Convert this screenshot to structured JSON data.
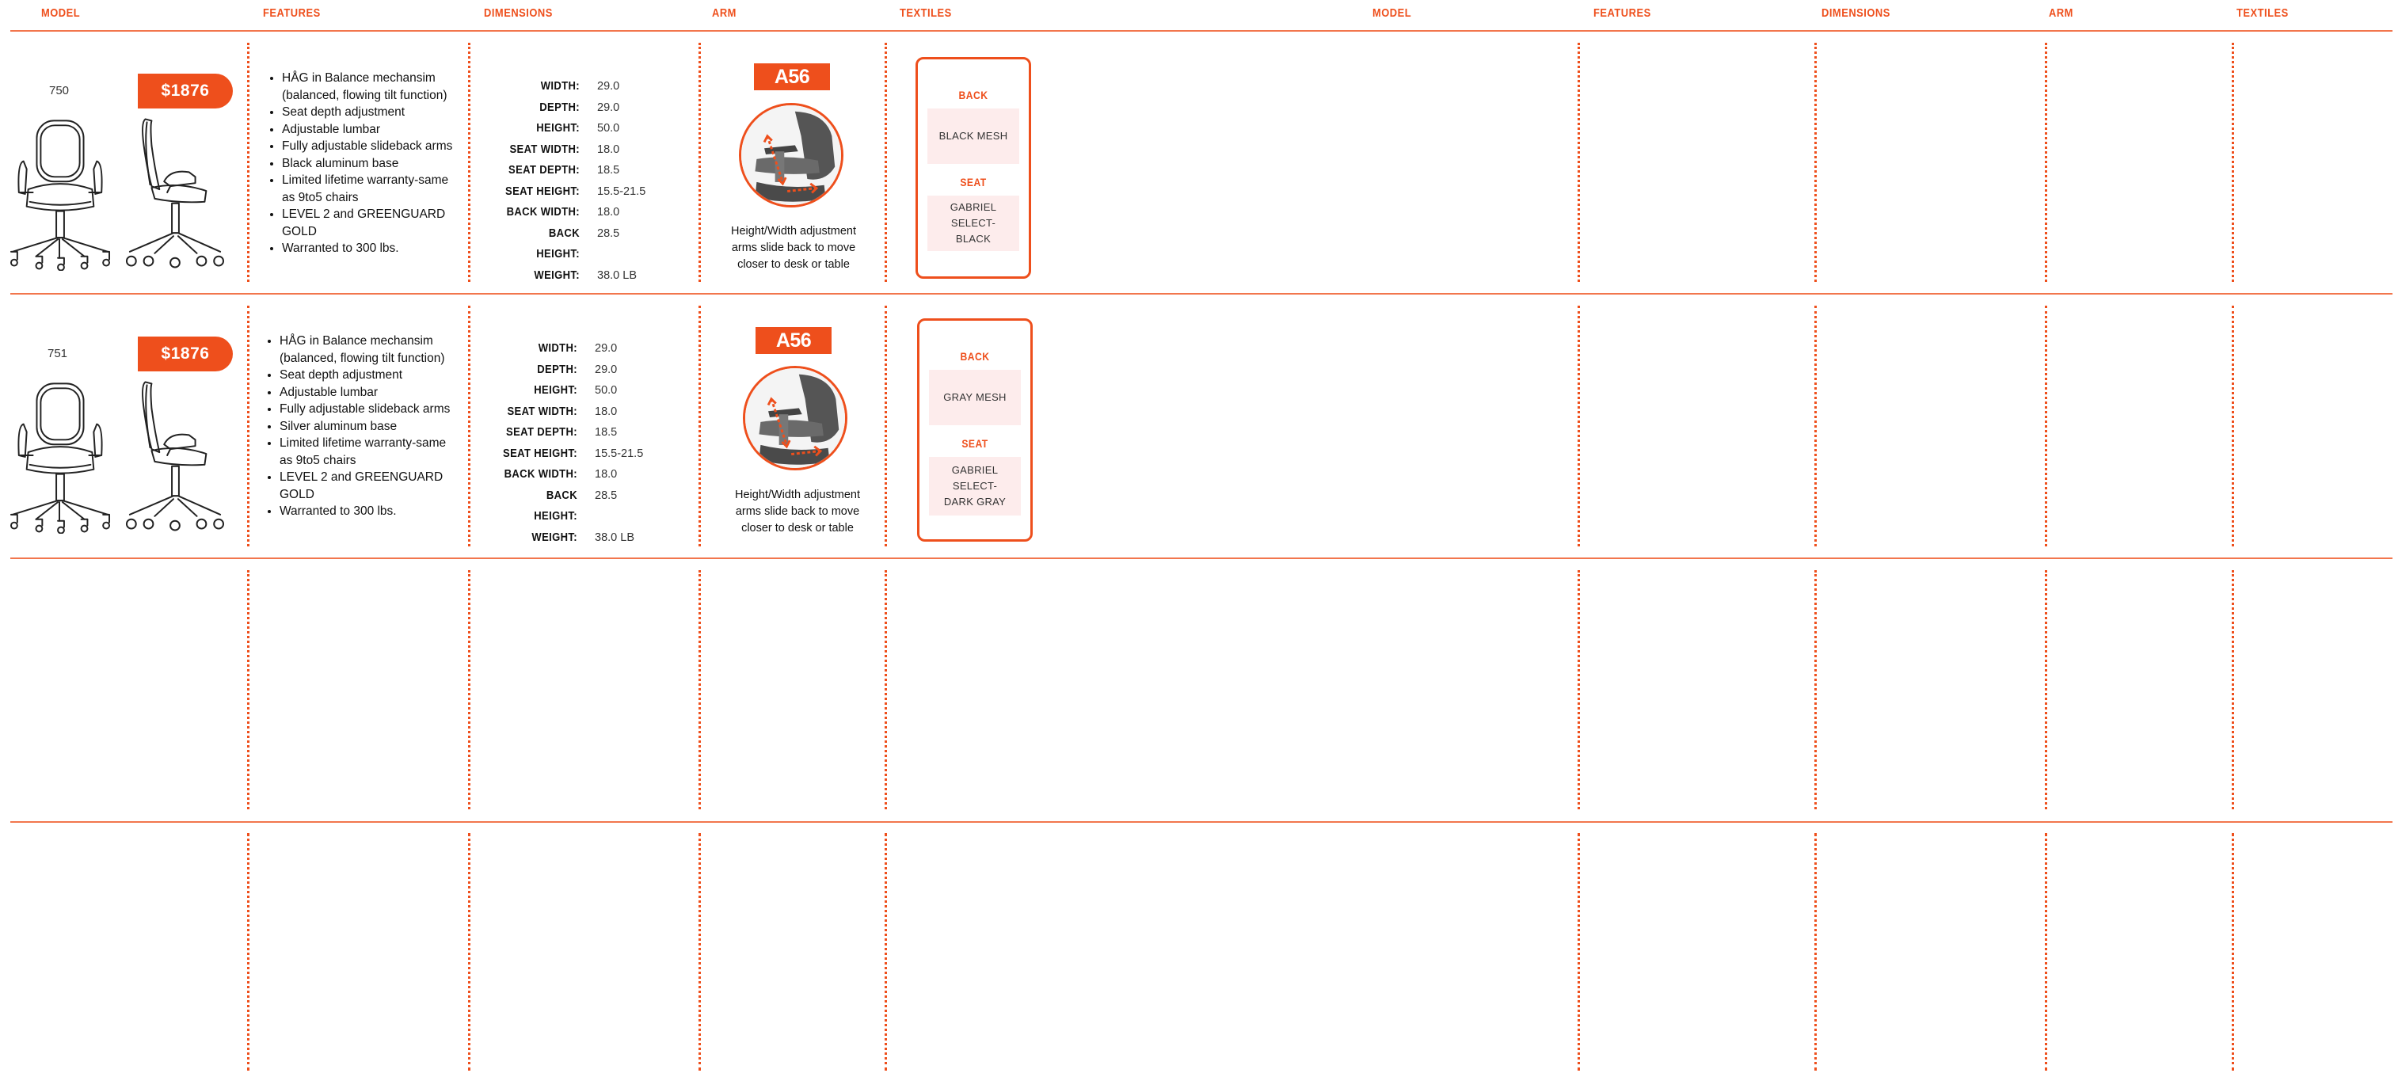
{
  "colors": {
    "accent": "#ee4f1c",
    "swatch": "#fdecec"
  },
  "headers": {
    "model": "MODEL",
    "features": "FEATURES",
    "dimensions": "DIMENSIONS",
    "arm": "ARM",
    "textiles": "TEXTILES"
  },
  "dimension_labels": {
    "width": "WIDTH:",
    "depth": "DEPTH:",
    "height": "HEIGHT:",
    "seat_width": "SEAT WIDTH:",
    "seat_depth": "SEAT DEPTH:",
    "seat_height": "SEAT HEIGHT:",
    "back_width": "BACK WIDTH:",
    "back_height": "BACK HEIGHT:",
    "weight": "WEIGHT:"
  },
  "textile_labels": {
    "back": "BACK",
    "seat": "SEAT"
  },
  "products": [
    {
      "model": "750",
      "price": "$1876",
      "features": [
        "HÅG in Balance  mechansim (balanced, flowing tilt function)",
        "Seat depth adjustment",
        "Adjustable lumbar",
        "Fully adjustable slideback arms",
        "Black aluminum base",
        "Limited lifetime warranty-same as 9to5 chairs",
        "LEVEL 2 and GREENGUARD GOLD",
        "Warranted to 300 lbs."
      ],
      "dimensions": {
        "width": "29.0",
        "depth": "29.0",
        "height": "50.0",
        "seat_width": "18.0",
        "seat_depth": "18.5",
        "seat_height": "15.5-21.5",
        "back_width": "18.0",
        "back_height": "28.5",
        "weight": "38.0 LB"
      },
      "arm": {
        "code": "A56",
        "icon": "arm-adjustment-photo",
        "caption": "Height/Width adjustment arms slide back to move closer to desk or table"
      },
      "textiles": {
        "back": "BLACK MESH",
        "seat": "GABRIEL SELECT-BLACK"
      }
    },
    {
      "model": "751",
      "price": "$1876",
      "features": [
        "HÅG in Balance  mechansim (balanced, flowing tilt function)",
        "Seat depth adjustment",
        "Adjustable lumbar",
        "Fully adjustable slideback arms",
        "Silver aluminum base",
        "Limited lifetime warranty-same as 9to5 chairs",
        "LEVEL 2 and GREENGUARD GOLD",
        "Warranted to 300 lbs."
      ],
      "dimensions": {
        "width": "29.0",
        "depth": "29.0",
        "height": "50.0",
        "seat_width": "18.0",
        "seat_depth": "18.5",
        "seat_height": "15.5-21.5",
        "back_width": "18.0",
        "back_height": "28.5",
        "weight": "38.0 LB"
      },
      "arm": {
        "code": "A56",
        "icon": "arm-adjustment-photo",
        "caption": "Height/Width adjustment arms slide back to move closer to desk or table"
      },
      "textiles": {
        "back": "GRAY MESH",
        "seat": "GABRIEL SELECT-DARK GRAY"
      }
    }
  ]
}
